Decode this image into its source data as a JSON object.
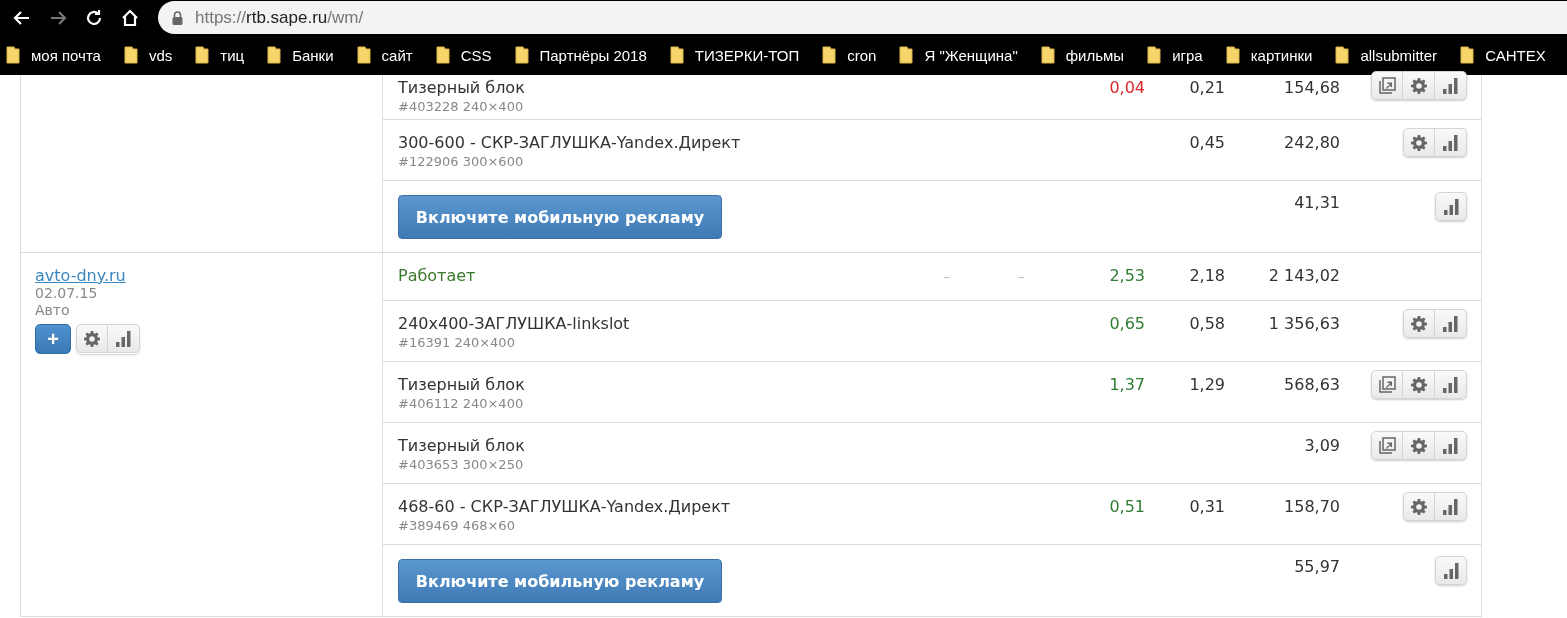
{
  "browser": {
    "nav": [
      {
        "kind": "back",
        "disabled": false
      },
      {
        "kind": "forward",
        "disabled": true
      },
      {
        "kind": "reload",
        "disabled": false
      },
      {
        "kind": "home",
        "disabled": false
      }
    ],
    "url": {
      "scheme": "https://",
      "host": "rtb.sape.ru",
      "path": "/wm/"
    },
    "bookmarks": [
      "моя почта",
      "vds",
      "тиц",
      "Банки",
      "сайт",
      "CSS",
      "Партнёры 2018",
      "ТИЗЕРКИ-ТОП",
      "cron",
      "Я \"Женщина\"",
      "фильмы",
      "игра",
      "картинки",
      "allsubmitter",
      "САНТЕХ"
    ]
  },
  "sites": [
    {
      "rows": [
        {
          "kind": "placement",
          "name": "Тизерный блок",
          "meta": "#403228 240×400",
          "column_3": {
            "text": "0,04",
            "color": "#d9262b"
          },
          "column_4": "0,21",
          "column_5": "154,68",
          "actions": [
            {
              "kind": "preview"
            },
            {
              "kind": "settings"
            },
            {
              "kind": "stats"
            }
          ]
        },
        {
          "kind": "placement",
          "name": "300-600 - СКР-ЗАГЛУШКА-Yandex.Директ",
          "meta": "#122906 300×600",
          "column_4": "0,45",
          "column_5": "242,80",
          "actions": [
            {
              "kind": "settings"
            },
            {
              "kind": "stats"
            }
          ]
        },
        {
          "kind": "mobile",
          "button": "Включите мобильную рекламу",
          "column_5": "41,31",
          "actions": [
            {
              "kind": "stats"
            }
          ]
        }
      ]
    },
    {
      "site": {
        "domain": "avto-dny.ru",
        "date": "02.07.15",
        "category": "Авто",
        "add": "+"
      },
      "rows": [
        {
          "kind": "status",
          "name": "Работает",
          "column_1": "–",
          "column_2": "–",
          "column_3": {
            "text": "2,53",
            "color": "#2f7d32"
          },
          "column_4": "2,18",
          "column_5": "2 143,02",
          "actions": []
        },
        {
          "kind": "placement",
          "name": "240x400-ЗАГЛУШКА-linkslot",
          "meta": "#16391 240×400",
          "column_3": {
            "text": "0,65",
            "color": "#2f7d32"
          },
          "column_4": "0,58",
          "column_5": "1 356,63",
          "actions": [
            {
              "kind": "settings"
            },
            {
              "kind": "stats"
            }
          ]
        },
        {
          "kind": "placement",
          "name": "Тизерный блок",
          "meta": "#406112 240×400",
          "column_3": {
            "text": "1,37",
            "color": "#2f7d32"
          },
          "column_4": "1,29",
          "column_5": "568,63",
          "actions": [
            {
              "kind": "preview"
            },
            {
              "kind": "settings"
            },
            {
              "kind": "stats"
            }
          ]
        },
        {
          "kind": "placement",
          "name": "Тизерный блок",
          "meta": "#403653 300×250",
          "column_5": "3,09",
          "actions": [
            {
              "kind": "preview"
            },
            {
              "kind": "settings"
            },
            {
              "kind": "stats"
            }
          ]
        },
        {
          "kind": "placement",
          "name": "468-60 - СКР-ЗАГЛУШКА-Yandex.Директ",
          "meta": "#389469 468×60",
          "column_3": {
            "text": "0,51",
            "color": "#2f7d32"
          },
          "column_4": "0,31",
          "column_5": "158,70",
          "actions": [
            {
              "kind": "settings"
            },
            {
              "kind": "stats"
            }
          ]
        },
        {
          "kind": "mobile",
          "button": "Включите мобильную рекламу",
          "column_5": "55,97",
          "actions": [
            {
              "kind": "stats"
            }
          ]
        }
      ]
    }
  ]
}
